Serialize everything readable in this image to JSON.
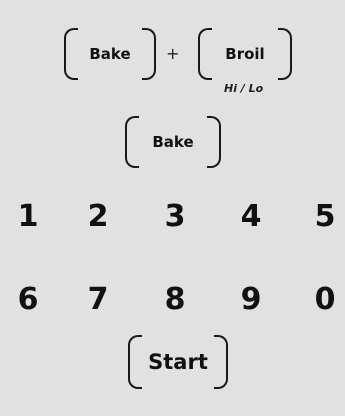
{
  "controls": {
    "bake_top_label": "Bake",
    "plus_symbol": "+",
    "broil_label": "Broil",
    "broil_sublabel": "Hi / Lo",
    "bake_mid_label": "Bake",
    "start_label": "Start"
  },
  "keypad": {
    "row1": [
      "1",
      "2",
      "3",
      "4",
      "5"
    ],
    "row2": [
      "6",
      "7",
      "8",
      "9",
      "0"
    ]
  }
}
